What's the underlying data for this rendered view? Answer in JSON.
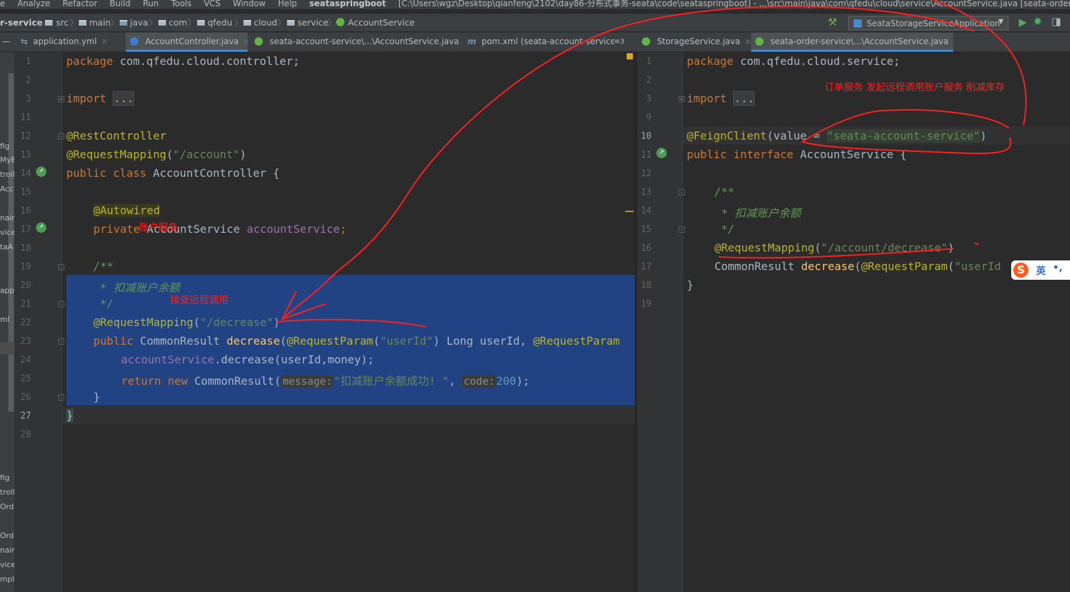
{
  "menubar": {
    "items": [
      "e",
      "Analyze",
      "Refactor",
      "Build",
      "Run",
      "Tools",
      "VCS",
      "Window",
      "Help"
    ],
    "project": "seataspringboot",
    "path": "[C:\\Users\\wgz\\Desktop\\qianfeng\\2102\\day86-分布式事务-seata\\code\\seataspringboot] - ...\\src\\main\\java\\com\\qfedu\\cloud\\service\\AccountService.java [seata-order-service]"
  },
  "breadcrumb": {
    "module": "r-service",
    "parts": [
      "src",
      "main",
      "java",
      "com",
      "qfedu",
      "cloud",
      "service",
      "AccountService"
    ]
  },
  "run_config": {
    "label": "SeataStorageServiceApplication"
  },
  "tabs_left": [
    {
      "label": "application.yml",
      "icon": "yaml-icon"
    },
    {
      "label": "AccountController.java",
      "icon": "class-icon",
      "active": true
    },
    {
      "label": "seata-account-service\\...\\AccountService.java",
      "icon": "interface-icon"
    },
    {
      "label": "pom.xml (seata-account-service",
      "icon": "maven-icon"
    },
    {
      "label": "≡3",
      "icon": "tab-list-icon"
    }
  ],
  "tabs_right": [
    {
      "label": "StorageService.java",
      "icon": "interface-icon"
    },
    {
      "label": "seata-order-service\\...\\AccountService.java",
      "icon": "interface-icon",
      "active": true
    }
  ],
  "left_strip_labels": [
    "fig",
    "MyB",
    "troll",
    "Acc",
    "nain",
    "vice",
    "taA",
    "app",
    "ml",
    "fig",
    "troll",
    "Ord",
    "Ord",
    "nain",
    "vice",
    "mpl"
  ],
  "left_editor": {
    "line_numbers": [
      "1",
      "2",
      "3",
      "11",
      "12",
      "13",
      "14",
      "15",
      "16",
      "17",
      "18",
      "19",
      "20",
      "21",
      "22",
      "23",
      "24",
      "25",
      "26",
      "27",
      "28"
    ],
    "lines": {
      "l1_kw": "package",
      "l1_rest": " com.qfedu.cloud.controller;",
      "l3_kw": "import",
      "l3_fold": "...",
      "l12": "@RestController",
      "l13_an": "@RequestMapping",
      "l13_p1": "(",
      "l13_str": "\"/account\"",
      "l13_p2": ")",
      "l14_kw": "public class",
      "l14_rest": " AccountController {",
      "l16": "@Autowired",
      "l17_kw": "private",
      "l17_type": " AccountService ",
      "l17_field": "accountService",
      "l17_end": ";",
      "l19": "/**",
      "l20": " * 扣减账户余额",
      "l21": " */",
      "l22_an": "@RequestMapping",
      "l22_p1": "(",
      "l22_str": "\"/decrease\"",
      "l22_p2": ")",
      "l23_kw": "public",
      "l23_a": " CommonResult ",
      "l23_fn": "decrease",
      "l23_b": "(",
      "l23_an": "@RequestParam",
      "l23_c": "(",
      "l23_str": "\"userId\"",
      "l23_d": ") Long userId, ",
      "l23_an2": "@RequestParam",
      "l24_field": "accountService",
      "l24_rest": ".decrease(userId,money);",
      "l25_kw": "return new",
      "l25_a": " CommonResult(",
      "l25_hint1": "message:",
      "l25_str": "\"扣减账户余额成功! \"",
      "l25_b": ", ",
      "l25_hint2": "code:",
      "l25_num": "200",
      "l25_c": ");",
      "l26": "}",
      "l27": "}"
    }
  },
  "right_editor": {
    "line_numbers": [
      "1",
      "2",
      "3",
      "9",
      "10",
      "11",
      "12",
      "13",
      "14",
      "15",
      "16",
      "17",
      "18",
      "19"
    ],
    "lines": {
      "l1_kw": "package",
      "l1_rest": " com.qfedu.cloud.service;",
      "l3_kw": "import",
      "l3_fold": "...",
      "l10_an": "@FeignClient",
      "l10_a": "(value = ",
      "l10_str": "\"seata-account-service\"",
      "l10_b": ")",
      "l11_kw": "public interface",
      "l11_rest": " AccountService {",
      "l13": "/**",
      "l14": " * 扣减账户余额",
      "l15": " */",
      "l16_an": "@RequestMapping",
      "l16_a": "(",
      "l16_str": "\"/account/decrease\"",
      "l16_b": ")",
      "l17_a": "CommonResult ",
      "l17_fn": "decrease",
      "l17_b": "(",
      "l17_an": "@RequestParam",
      "l17_c": "(",
      "l17_str": "\"userId",
      "l18": "}"
    }
  },
  "annotations": {
    "account_service_note": "账户服务",
    "receive_remote_call_note": "接受远程调用",
    "order_service_note": "订单服务 发起远程调用账户服务 削减库存"
  },
  "ime": {
    "logo": "S",
    "mode": "英",
    "punct": "•,"
  },
  "colors": {
    "editor_bg": "#2b2b2b",
    "selection": "#214283",
    "keyword": "#cc7832",
    "annotation": "#bbb529",
    "string": "#6a8759",
    "comment": "#629755",
    "field": "#9876aa",
    "red_annotation": "#ff2020"
  }
}
